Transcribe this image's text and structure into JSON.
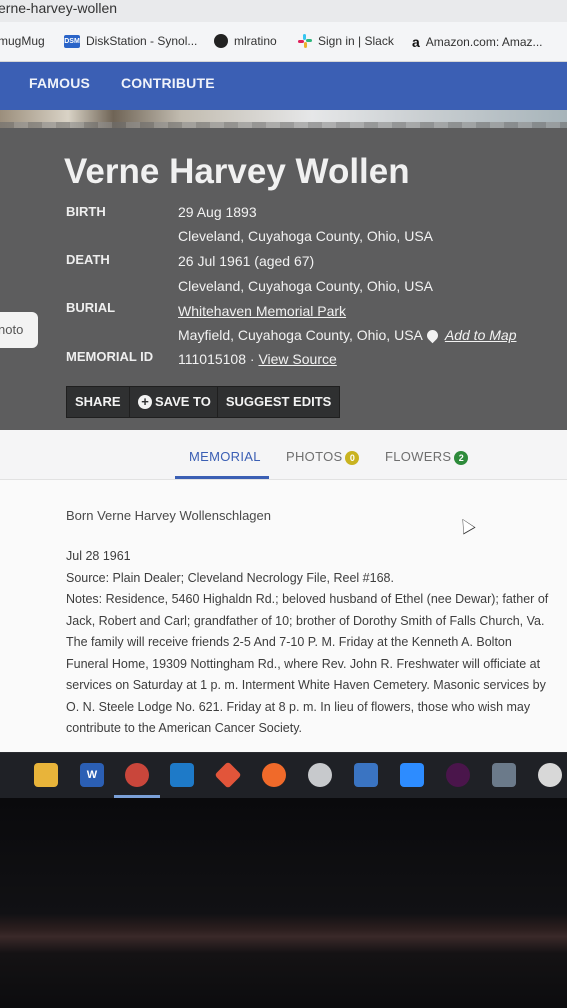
{
  "browser": {
    "tab_title": "erne-harvey-wollen",
    "bookmarks": [
      {
        "label": "mugMug",
        "icon": "smugmug-icon"
      },
      {
        "label": "DiskStation - Synol...",
        "icon": "dsm-icon",
        "icon_text": "DSM"
      },
      {
        "label": "mlratino",
        "icon": "github-icon"
      },
      {
        "label": "Sign in | Slack",
        "icon": "slack-icon"
      },
      {
        "label": "Amazon.com: Amaz...",
        "icon": "amazon-icon",
        "icon_text": "a"
      }
    ]
  },
  "site_nav": {
    "links": [
      "FAMOUS",
      "CONTRIBUTE"
    ]
  },
  "memorial": {
    "name": "Verne Harvey Wollen",
    "birth_label": "BIRTH",
    "birth_date": "29 Aug 1893",
    "birth_place": "Cleveland, Cuyahoga County, Ohio, USA",
    "death_label": "DEATH",
    "death_date": "26 Jul 1961 (aged 67)",
    "death_place": "Cleveland, Cuyahoga County, Ohio, USA",
    "burial_label": "BURIAL",
    "burial_cemetery": "Whitehaven Memorial Park",
    "burial_place": "Mayfield, Cuyahoga County, Ohio, USA",
    "add_to_map": "Add to Map",
    "memorial_id_label": "MEMORIAL ID",
    "memorial_id": "111015108",
    "id_separator": "·",
    "view_source": "View Source",
    "photo_tab": "noto"
  },
  "actions": {
    "share": "SHARE",
    "save_to": "SAVE TO",
    "suggest_edits": "SUGGEST EDITS"
  },
  "tabs": {
    "memorial": "MEMORIAL",
    "photos": "PHOTOS",
    "photos_count": "0",
    "flowers": "FLOWERS",
    "flowers_count": "2"
  },
  "bio": {
    "born": "Born Verne Harvey Wollenschlagen",
    "lines": [
      "Jul 28 1961",
      "Source: Plain Dealer; Cleveland Necrology File, Reel #168.",
      "Notes: Residence, 5460 Highaldn Rd.; beloved husband of Ethel (nee Dewar); father of",
      "Jack, Robert and Carl; grandfather of 10; brother of Dorothy Smith of Falls Church, Va.",
      "The family will receive friends 2-5 And 7-10 P. M. Friday at the Kenneth A. Bolton",
      "Funeral Home, 19309 Nottingham Rd., where Rev. John R. Freshwater will officiate at",
      "services on Saturday at 1 p. m. Interment White Haven Cemetery. Masonic services by",
      "O. N. Steele Lodge No. 621. Friday at 8 p. m. In lieu of flowers, those who wish may",
      "contribute to the American Cancer Society."
    ]
  },
  "taskbar": {
    "apps": [
      "file-explorer-icon",
      "word-icon",
      "chrome-icon",
      "vscode-icon",
      "git-icon",
      "swift-icon",
      "app-icon",
      "screen-icon",
      "zoom-icon",
      "slack-icon",
      "camera-icon",
      "clock-icon"
    ],
    "word_letter": "W"
  },
  "colors": {
    "nav_blue": "#3b5fb4",
    "header_gray": "#5d5d5e",
    "count_green": "#2e8b3b"
  }
}
